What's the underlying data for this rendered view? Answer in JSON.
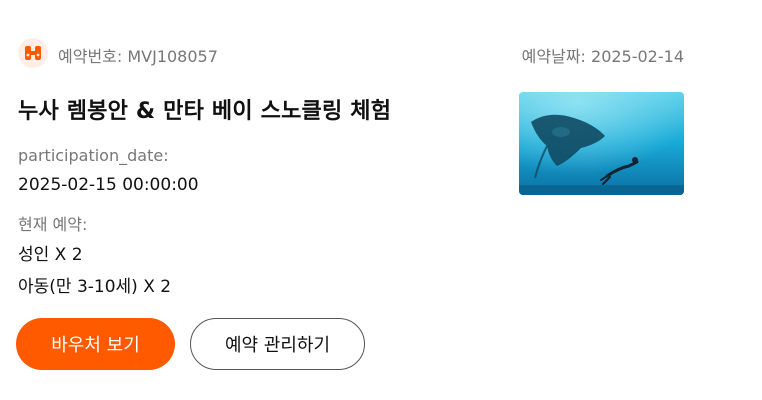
{
  "header": {
    "booking_number": "예약번호: MVJ108057",
    "booking_date": "예약날짜: 2025-02-14"
  },
  "product": {
    "title": "누사 렘봉안 & 만타 베이 스노클링 체험",
    "image_icon": "manta-ray-snorkel-photo"
  },
  "participation": {
    "label": "participation_date:",
    "value": "2025-02-15 00:00:00"
  },
  "reservation": {
    "label": "현재 예약:",
    "items": [
      "성인 X 2",
      "아동(만 3-10세) X 2"
    ]
  },
  "actions": {
    "voucher_label": "바우처 보기",
    "manage_label": "예약 관리하기"
  },
  "colors": {
    "accent": "#ff5a00",
    "logo_bg": "#fdeee6"
  }
}
